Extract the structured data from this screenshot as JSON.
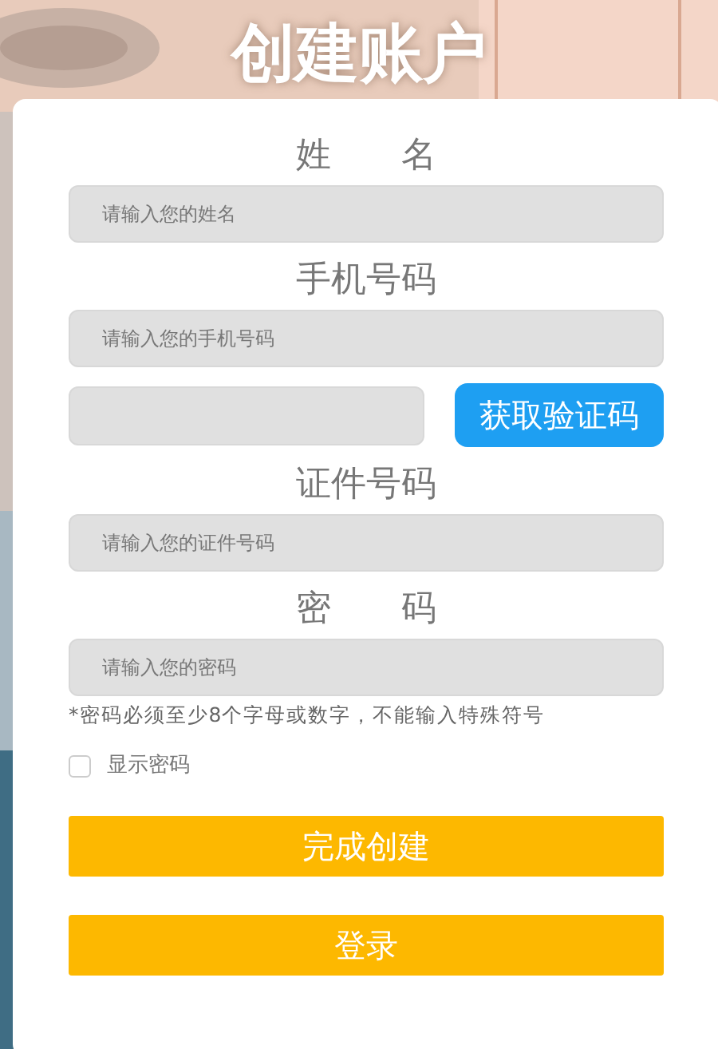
{
  "title": "创建账户",
  "fields": [
    {
      "kind": "text",
      "label": "姓　　名",
      "placeholder": "请输入您的姓名"
    },
    {
      "kind": "text",
      "label": "手机号码",
      "placeholder": "请输入您的手机号码"
    },
    {
      "kind": "code",
      "button": "获取验证码"
    },
    {
      "kind": "text",
      "label": "证件号码",
      "placeholder": "请输入您的证件号码"
    },
    {
      "kind": "text",
      "label": "密　　码",
      "placeholder": "请输入您的密码"
    }
  ],
  "note": "*密码必须至少8个字母或数字，不能输入特殊符号",
  "show_password": {
    "label": "显示密码",
    "checked": false
  },
  "buttons": [
    "完成创建",
    "登录"
  ]
}
